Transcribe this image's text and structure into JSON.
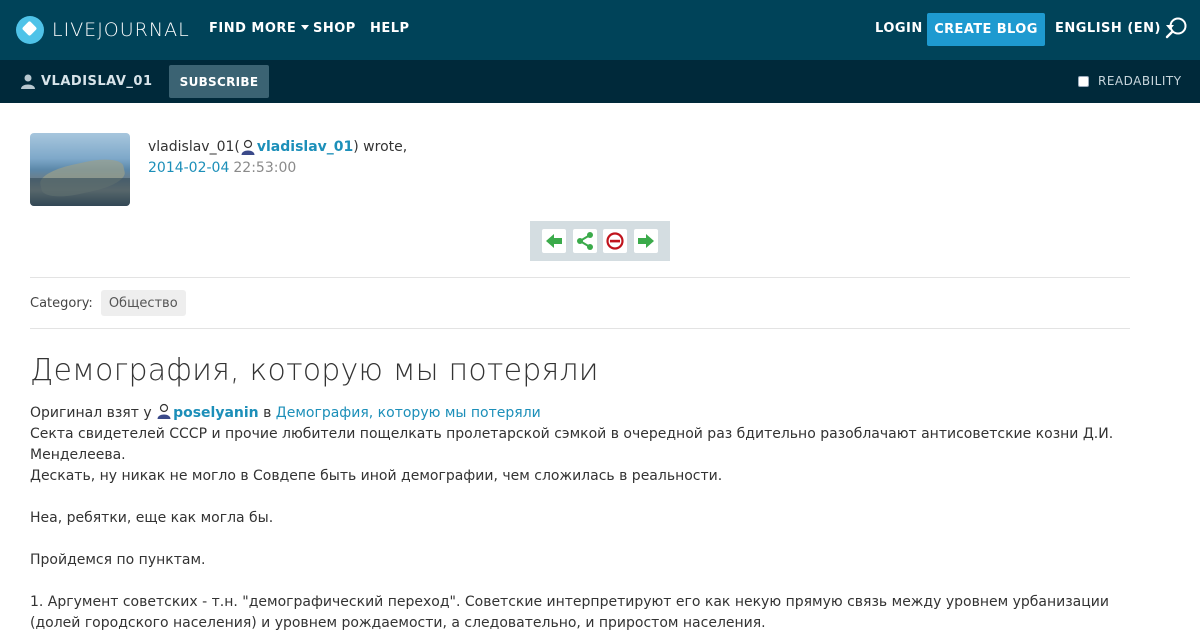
{
  "topnav": {
    "logo_text": "LIVEJOURNAL",
    "find_more": "FIND MORE",
    "shop": "SHOP",
    "help": "HELP",
    "login": "LOGIN",
    "create_blog": "CREATE BLOG",
    "language": "ENGLISH (EN)"
  },
  "journalbar": {
    "username": "VLADISLAV_01",
    "subscribe": "SUBSCRIBE",
    "readability": "READABILITY",
    "readability_checked": false
  },
  "entry": {
    "author_display": "vladislav_01",
    "author_link": "vladislav_01",
    "wrote": ") wrote,",
    "open_paren": " (",
    "date": "2014-02-04",
    "time": "22:53:00",
    "category_label": "Category:",
    "category": "Общество",
    "title": "Демография, которую мы потеряли",
    "source_prefix": "Оригинал взят у ",
    "source_user": "poselyanin",
    "source_in": " в ",
    "source_link": "Демография, которую мы потеряли",
    "paragraphs": [
      "Секта свидетелей СССР и прочие любители пощелкать пролетарской сэмкой в очередной раз бдительно разоблачают антисоветские козни Д.И. Менделеева.",
      "Дескать, ну никак не могло в Совдепе быть иной демографии, чем сложилась в реальности.",
      "",
      "Неа, ребятки, еще как могла бы.",
      "",
      "Пройдемся по пунктам.",
      "",
      "1. Аргумент советских - т.н. \"демографический переход\". Советские интерпретируют его как некую прямую связь между уровнем урбанизации (долей городского населения) и уровнем рождаемости, а следовательно, и приростом населения."
    ]
  },
  "actions": {
    "icons": [
      "arrow-left-icon",
      "share-icon",
      "block-icon",
      "arrow-right-icon"
    ]
  },
  "colors": {
    "topbar": "#004359",
    "journalbar": "#00293a",
    "accent": "#1e9ad0",
    "link": "#1c8fb9",
    "action_green": "#3aaa4a",
    "action_red": "#c0141d"
  }
}
